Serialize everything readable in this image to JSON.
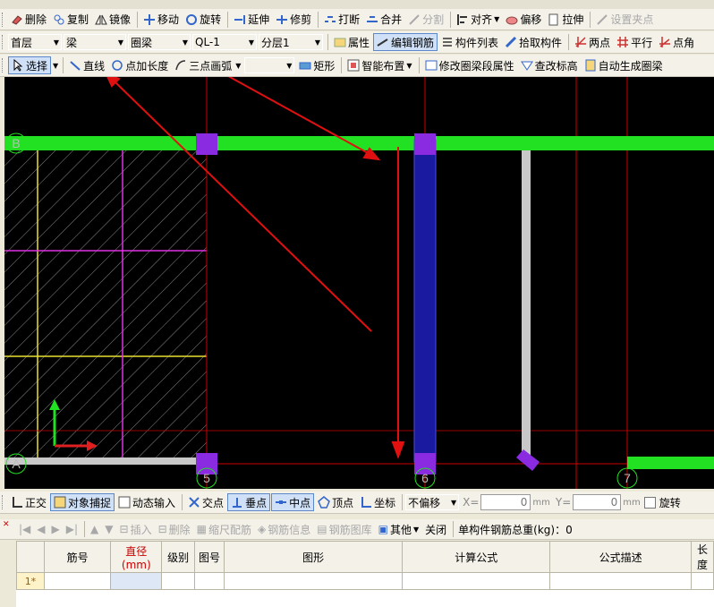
{
  "toolbar1": {
    "items": [
      "删除",
      "复制",
      "镜像",
      "移动",
      "旋转",
      "延伸",
      "修剪",
      "打断",
      "合并",
      "分割",
      "对齐",
      "偏移",
      "拉伸",
      "设置夹点"
    ],
    "disabled": [
      "分割",
      "设置夹点"
    ]
  },
  "toolbar2": {
    "floor": "首层",
    "category": "梁",
    "type": "圈梁",
    "component": "QL-1",
    "layer": "分层1",
    "buttons": [
      "属性",
      "编辑钢筋",
      "构件列表",
      "拾取构件",
      "两点",
      "平行",
      "点角"
    ]
  },
  "toolbar3": {
    "select": "选择",
    "buttons": [
      "直线",
      "点加长度",
      "三点画弧",
      "矩形",
      "智能布置",
      "修改圈梁段属性",
      "查改标高",
      "自动生成圈梁"
    ],
    "combo_empty": ""
  },
  "canvas": {
    "axis_labels": [
      "B",
      "A",
      "5",
      "6",
      "7"
    ]
  },
  "status_bar": {
    "buttons": [
      "正交",
      "对象捕捉",
      "动态输入",
      "交点",
      "垂点",
      "中点",
      "顶点",
      "坐标"
    ],
    "offset": "不偏移",
    "x_label": "X=",
    "x_value": "0",
    "y_label": "Y=",
    "y_value": "0",
    "unit": "mm",
    "rotate": "旋转"
  },
  "rebar_toolbar": {
    "buttons": [
      "插入",
      "删除",
      "缩尺配筋",
      "钢筋信息",
      "钢筋图库",
      "其他",
      "关闭"
    ],
    "total_label": "单构件钢筋总重(kg)：0"
  },
  "rebar_table": {
    "columns": [
      "筋号",
      "直径(mm)",
      "级别",
      "图号",
      "图形",
      "计算公式",
      "公式描述",
      "长度"
    ],
    "rows": [
      {
        "index": "1*"
      }
    ]
  }
}
